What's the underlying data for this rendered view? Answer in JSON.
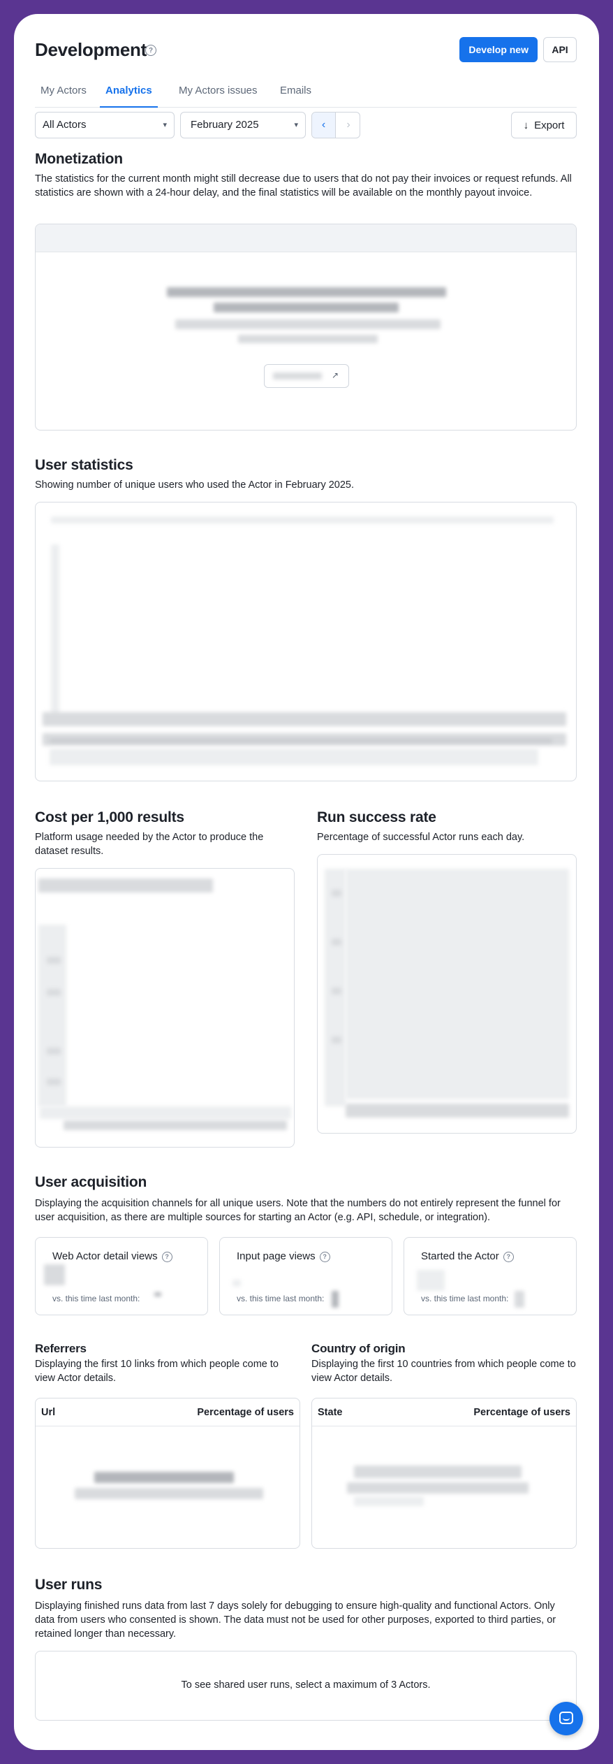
{
  "header": {
    "title": "Development",
    "develop_new": "Develop new",
    "api": "API"
  },
  "tabs": [
    {
      "label": "My Actors"
    },
    {
      "label": "Analytics"
    },
    {
      "label": "My Actors issues"
    },
    {
      "label": "Emails"
    }
  ],
  "toolbar": {
    "actors_select": "All Actors",
    "month_select": "February 2025",
    "prev": "‹",
    "next": "›",
    "export": "Export",
    "export_icon": "↓"
  },
  "monetization": {
    "title": "Monetization",
    "desc": "The statistics for the current month might still decrease due to users that do not pay their invoices or request refunds. All statistics are shown with a 24-hour delay, and the final statistics will be available on the monthly payout invoice."
  },
  "user_statistics": {
    "title": "User statistics",
    "desc": "Showing number of unique users who used the Actor in February 2025."
  },
  "cost": {
    "title": "Cost per 1,000 results",
    "desc": "Platform usage needed by the Actor to produce the dataset results."
  },
  "success": {
    "title": "Run success rate",
    "desc": "Percentage of successful Actor runs each day."
  },
  "acquisition": {
    "title": "User acquisition",
    "desc": "Displaying the acquisition channels for all unique users. Note that the numbers do not entirely represent the funnel for user acquisition, as there are multiple sources for starting an Actor (e.g. API, schedule, or integration).",
    "metrics": [
      {
        "label": "Web Actor detail views",
        "sub": "vs. this time last month:"
      },
      {
        "label": "Input page views",
        "sub": "vs. this time last month:"
      },
      {
        "label": "Started the Actor",
        "sub": "vs. this time last month:"
      }
    ]
  },
  "referrers": {
    "title": "Referrers",
    "desc": "Displaying the first 10 links from which people come to view Actor details.",
    "col1": "Url",
    "col2": "Percentage of users"
  },
  "country": {
    "title": "Country of origin",
    "desc": "Displaying the first 10 countries from which people come to view Actor details.",
    "col1": "State",
    "col2": "Percentage of users"
  },
  "user_runs": {
    "title": "User runs",
    "desc": "Displaying finished runs data from last 7 days solely for debugging to ensure high-quality and functional Actors. Only data from users who consented is shown. The data must not be used for other purposes, exported to third parties, or retained longer than necessary.",
    "empty": "To see shared user runs, select a maximum of 3 Actors."
  },
  "help_glyph": "?"
}
